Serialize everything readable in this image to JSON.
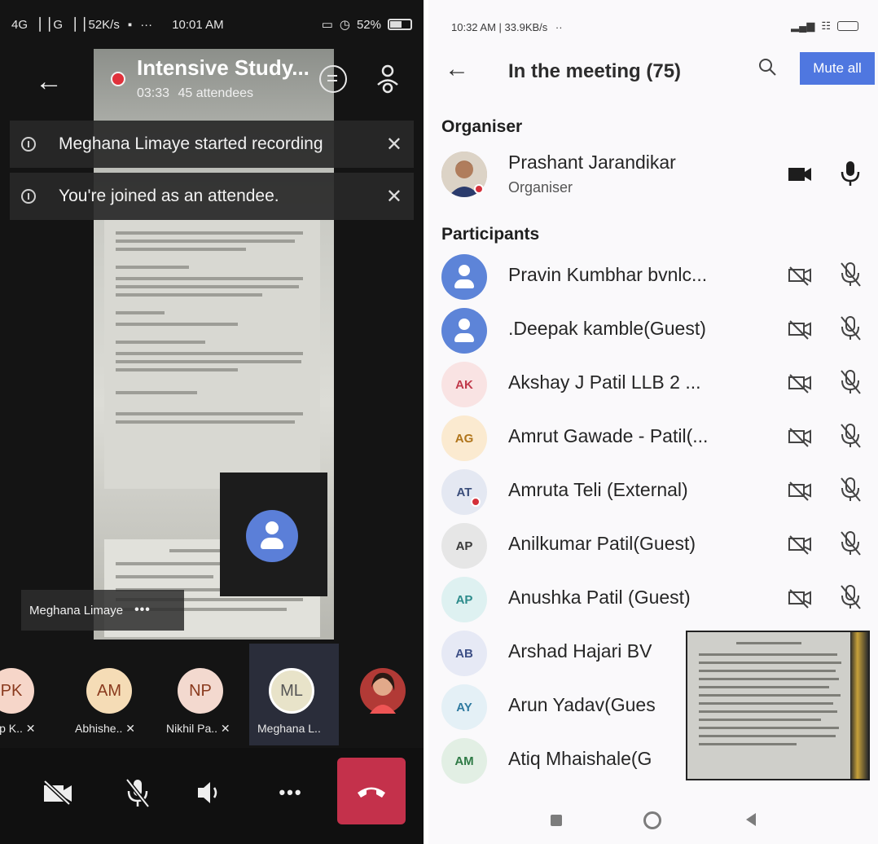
{
  "left_phone": {
    "status_bar": {
      "network": "4G ▕▕ G ▕▕ 52K/s",
      "more": "···",
      "time": "10:01 AM",
      "battery": "52%"
    },
    "meeting": {
      "title": "Intensive Study...",
      "timer": "03:33",
      "attendees": "45 attendees"
    },
    "banners": [
      {
        "text": "Meghana Limaye started recording",
        "close": "✕"
      },
      {
        "text": "You're joined as an attendee.",
        "close": "✕"
      }
    ],
    "active_speaker_label": "Meghana Limaye",
    "active_speaker_more": "•••",
    "roster": [
      {
        "initials": "PK",
        "name": "ip K..",
        "color": "#f6d6c9"
      },
      {
        "initials": "AM",
        "name": "Abhishe..",
        "color": "#f5dcb6"
      },
      {
        "initials": "NP",
        "name": "Nikhil Pa..",
        "color": "#f3d9cf"
      },
      {
        "initials": "ML",
        "name": "Meghana L..",
        "color": "#e8e3c9"
      }
    ],
    "controls": {
      "more": "•••"
    }
  },
  "right_phone": {
    "status_bar": {
      "time": "10:32 AM | 33.9KB/s",
      "more": "··"
    },
    "title": "In the meeting (75)",
    "mute_all_label": "Mute all",
    "organiser_heading": "Organiser",
    "organiser": {
      "name": "Prashant Jarandikar",
      "role": "Organiser"
    },
    "participants_heading": "Participants",
    "participants": [
      {
        "name": "Pravin Kumbhar bvnlc...",
        "initials": "",
        "avatar_color": "#5d84d8",
        "text_color": "#ffffff"
      },
      {
        "name": ".Deepak kamble(Guest)",
        "initials": "",
        "avatar_color": "#5d84d8",
        "text_color": "#ffffff"
      },
      {
        "name": "Akshay J Patil LLB 2 ...",
        "initials": "AK",
        "avatar_color": "#f9e3e3",
        "text_color": "#c0394a"
      },
      {
        "name": "Amrut Gawade - Patil(...",
        "initials": "AG",
        "avatar_color": "#fbead0",
        "text_color": "#b0741a"
      },
      {
        "name": "Amruta Teli (External)",
        "initials": "AT",
        "avatar_color": "#e4e8f2",
        "text_color": "#3a4d7a"
      },
      {
        "name": "Anilkumar Patil(Guest)",
        "initials": "AP",
        "avatar_color": "#e6e6e6",
        "text_color": "#3a3a3a"
      },
      {
        "name": "Anushka Patil (Guest)",
        "initials": "AP",
        "avatar_color": "#def1f1",
        "text_color": "#2c8b8b"
      },
      {
        "name": "Arshad Hajari BV",
        "initials": "AB",
        "avatar_color": "#e6e9f5",
        "text_color": "#3d4f86"
      },
      {
        "name": "Arun Yadav(Gues",
        "initials": "AY",
        "avatar_color": "#e4f0f6",
        "text_color": "#2f7aa0"
      },
      {
        "name": "Atiq Mhaishale(G",
        "initials": "AM",
        "avatar_color": "#e2efe4",
        "text_color": "#2e7a45"
      }
    ]
  }
}
